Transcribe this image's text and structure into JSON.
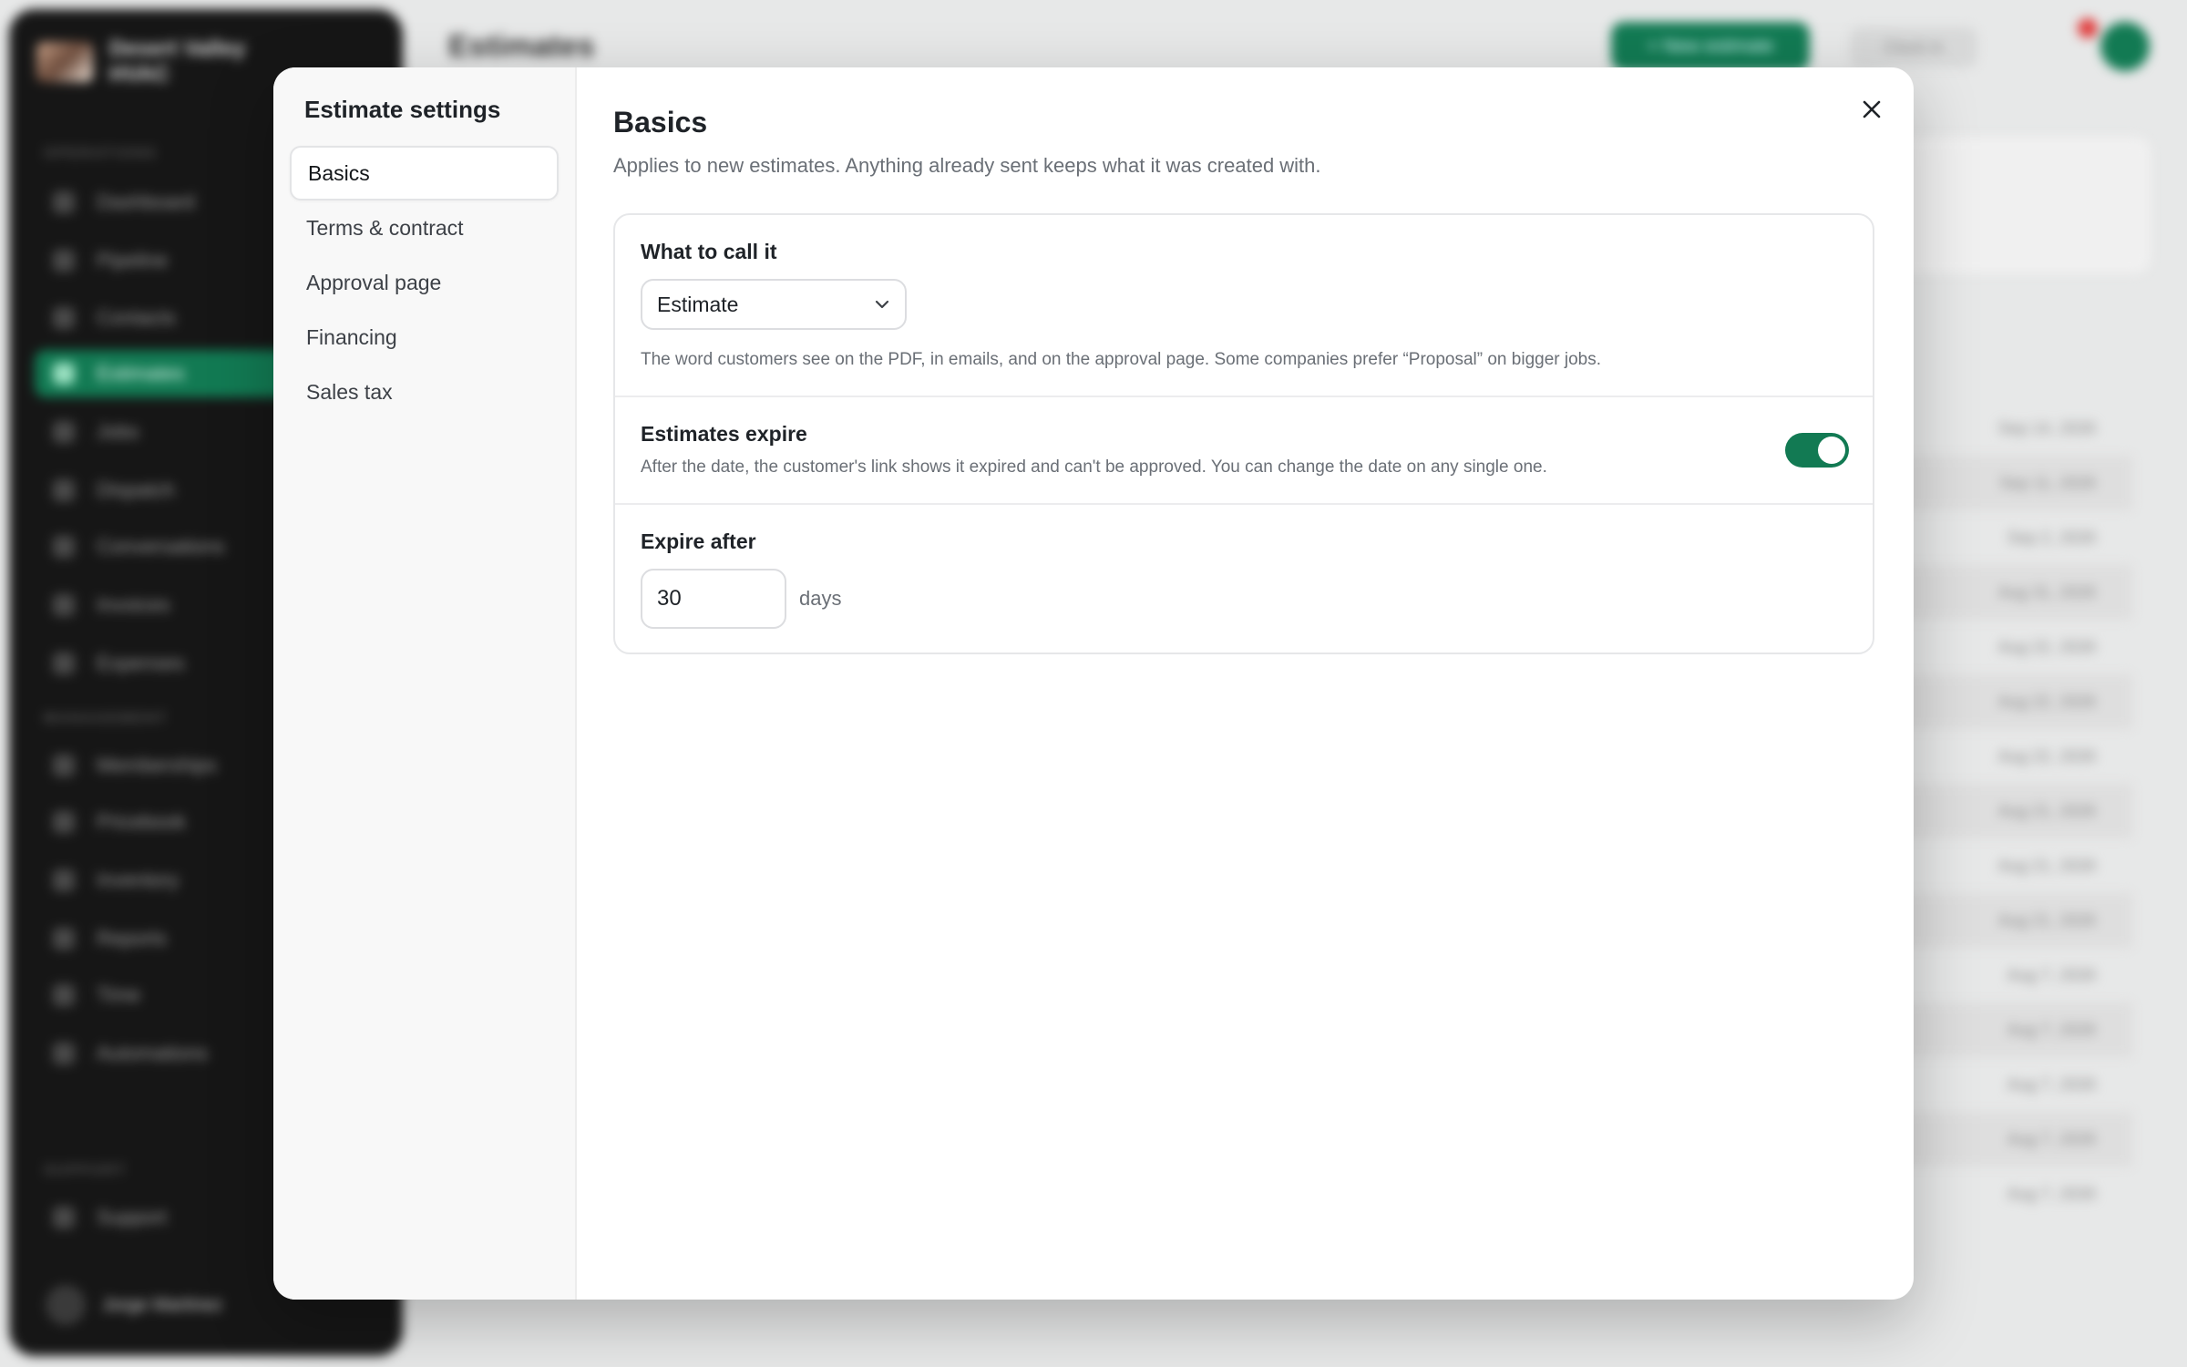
{
  "background": {
    "brand_name": "Desert Valley HVAC",
    "page_title": "Estimates",
    "new_button": "+ New estimate",
    "clock_button": "Clock in",
    "section_labels": [
      "OPERATIONS",
      "MANAGEMENT",
      "SUPPORT"
    ],
    "nav": [
      "Dashboard",
      "Pipeline",
      "Contacts",
      "Estimates",
      "Jobs",
      "Dispatch",
      "Conversations",
      "Invoices",
      "Expenses",
      "Memberships",
      "Pricebook",
      "Inventory",
      "Reports",
      "Time",
      "Automations",
      "Support"
    ],
    "user_name": "Jorge Martinez",
    "row_dates": [
      "Sep 14, 2026",
      "Sep 11, 2026",
      "Sep 2, 2026",
      "Aug 31, 2026",
      "Aug 22, 2026",
      "Aug 22, 2026",
      "Aug 22, 2026",
      "Aug 21, 2026",
      "Aug 21, 2026",
      "Aug 21, 2026",
      "Aug 7, 2026",
      "Aug 7, 2026",
      "Aug 7, 2026",
      "Aug 7, 2026",
      "Aug 7, 2026"
    ]
  },
  "modal": {
    "title": "Estimate settings",
    "nav": [
      {
        "label": "Basics",
        "active": true
      },
      {
        "label": "Terms & contract",
        "active": false
      },
      {
        "label": "Approval page",
        "active": false
      },
      {
        "label": "Financing",
        "active": false
      },
      {
        "label": "Sales tax",
        "active": false
      }
    ],
    "heading": "Basics",
    "subheading": "Applies to new estimates. Anything already sent keeps what it was created with.",
    "name_section": {
      "label": "What to call it",
      "selected": "Estimate",
      "help": "The word customers see on the PDF, in emails, and on the approval page. Some companies prefer “Proposal” on bigger jobs."
    },
    "expire_section": {
      "label": "Estimates expire",
      "help": "After the date, the customer's link shows it expired and can't be approved. You can change the date on any single one.",
      "enabled": true
    },
    "expire_after": {
      "label": "Expire after",
      "value": "30",
      "unit": "days"
    }
  },
  "colors": {
    "accent": "#127a53"
  }
}
